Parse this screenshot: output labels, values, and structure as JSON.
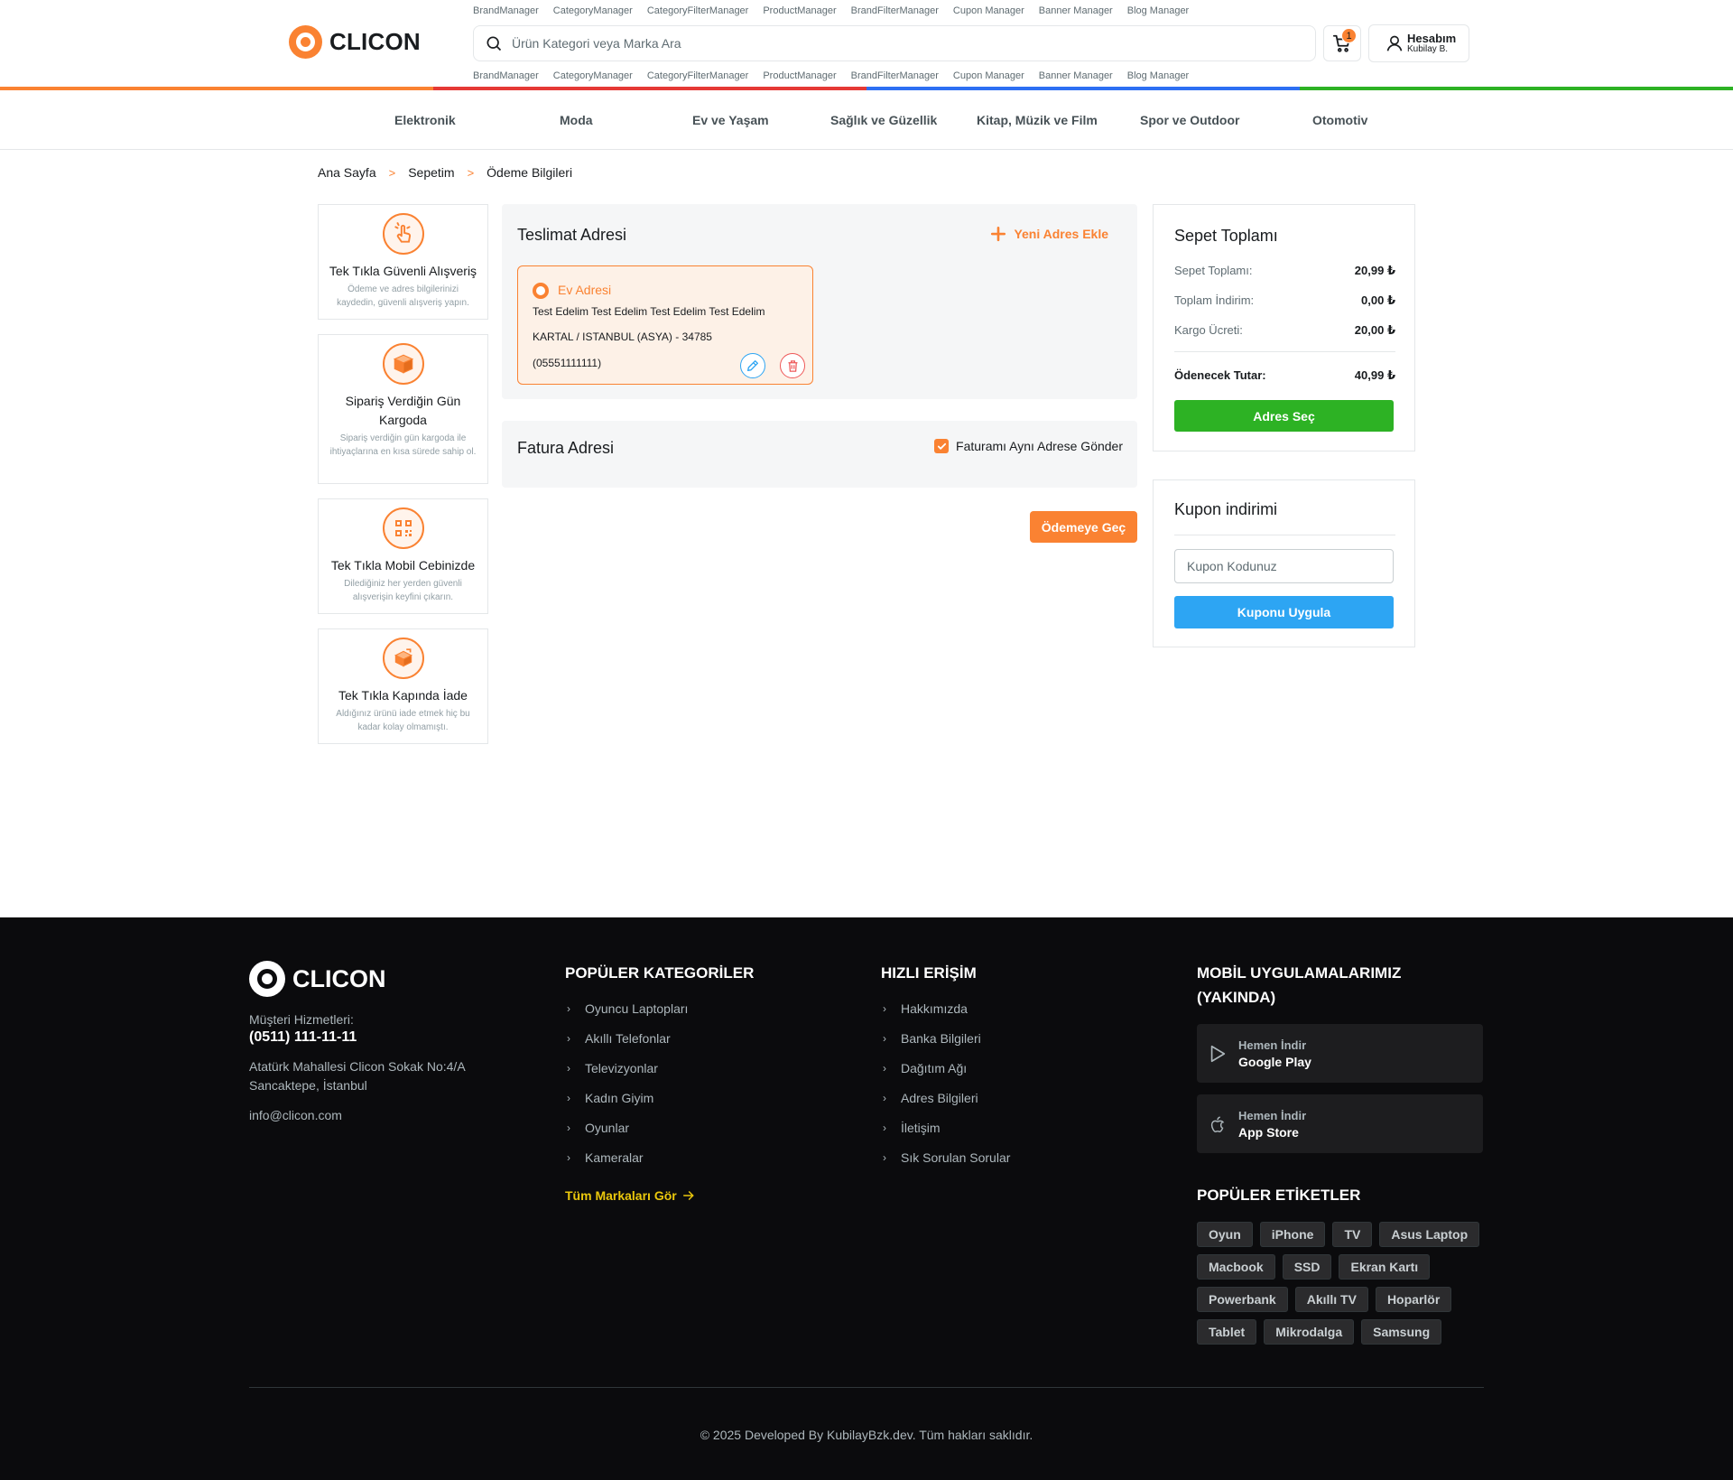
{
  "header": {
    "brand": "CLICON",
    "admin_links": [
      "BrandManager",
      "CategoryManager",
      "CategoryFilterManager",
      "ProductManager",
      "BrandFilterManager",
      "Cupon Manager",
      "Banner Manager",
      "Blog Manager"
    ],
    "search_placeholder": "Ürün Kategori veya Marka Ara",
    "cart_count": "1",
    "account_label": "Hesabım",
    "account_user": "Kubilay B.",
    "color_bar": [
      "#fa8232",
      "#e53935",
      "#2d6ff3",
      "#2db224"
    ]
  },
  "categories": [
    "Elektronik",
    "Moda",
    "Ev ve Yaşam",
    "Sağlık ve Güzellik",
    "Kitap, Müzik ve Film",
    "Spor ve Outdoor",
    "Otomotiv"
  ],
  "breadcrumb": [
    "Ana Sayfa",
    "Sepetim",
    "Ödeme Bilgileri"
  ],
  "features": [
    {
      "title": "Tek Tıkla Güvenli Alışveriş",
      "desc": "Ödeme ve adres bilgilerinizi kaydedin, güvenli alışveriş yapın.",
      "icon": "tap-icon"
    },
    {
      "title": "Sipariş Verdiğin Gün Kargoda",
      "desc": "Sipariş verdiğin gün kargoda ile ihtiyaçlarına en kısa sürede sahip ol.",
      "icon": "box-icon"
    },
    {
      "title": "Tek Tıkla Mobil Cebinizde",
      "desc": "Dilediğiniz her yerden güvenli alışverişin keyfini çıkarın.",
      "icon": "qr-icon"
    },
    {
      "title": "Tek Tıkla Kapında İade",
      "desc": "Aldığınız ürünü iade etmek hiç bu kadar kolay olmamıştı.",
      "icon": "return-icon"
    }
  ],
  "delivery": {
    "title": "Teslimat Adresi",
    "add_label": "Yeni Adres Ekle",
    "address": {
      "name": "Ev Adresi",
      "line1": "Test Edelim Test Edelim Test Edelim Test Edelim",
      "line2": "KARTAL / ISTANBUL (ASYA) - 34785",
      "phone": "(05551111111)"
    }
  },
  "invoice": {
    "title": "Fatura Adresi",
    "same_address_label": "Faturamı Aynı Adrese Gönder",
    "same_address_checked": true
  },
  "proceed_label": "Ödemeye Geç",
  "summary": {
    "title": "Sepet Toplamı",
    "rows": [
      {
        "label": "Sepet Toplamı:",
        "value": "20,99 ₺"
      },
      {
        "label": "Toplam İndirim:",
        "value": "0,00 ₺"
      },
      {
        "label": "Kargo Ücreti:",
        "value": "20,00 ₺"
      }
    ],
    "total_label": "Ödenecek Tutar:",
    "total_value": "40,99 ₺",
    "button": "Adres Seç"
  },
  "coupon": {
    "title": "Kupon indirimi",
    "placeholder": "Kupon Kodunuz",
    "button": "Kuponu Uygula"
  },
  "footer": {
    "brand": "CLICON",
    "support_label": "Müşteri Hizmetleri:",
    "phone": "(0511) 111-11-11",
    "address": "Atatürk Mahallesi Clicon Sokak No:4/A Sancaktepe, İstanbul",
    "email": "info@clicon.com",
    "popular_title": "POPÜLER KATEGORİLER",
    "popular": [
      "Oyuncu Laptopları",
      "Akıllı Telefonlar",
      "Televizyonlar",
      "Kadın Giyim",
      "Oyunlar",
      "Kameralar"
    ],
    "all_brands": "Tüm Markaları Gör",
    "quick_title": "HIZLI ERİŞİM",
    "quick": [
      "Hakkımızda",
      "Banka Bilgileri",
      "Dağıtım Ağı",
      "Adres Bilgileri",
      "İletişim",
      "Sık Sorulan Sorular"
    ],
    "apps_title": "MOBİL UYGULAMALARIMIZ (YAKINDA)",
    "apps": [
      {
        "top": "Hemen İndir",
        "name": "Google Play"
      },
      {
        "top": "Hemen İndir",
        "name": "App Store"
      }
    ],
    "tags_title": "POPÜLER ETİKETLER",
    "tags": [
      "Oyun",
      "iPhone",
      "TV",
      "Asus Laptop",
      "Macbook",
      "SSD",
      "Ekran Kartı",
      "Powerbank",
      "Akıllı TV",
      "Hoparlör",
      "Tablet",
      "Mikrodalga",
      "Samsung"
    ],
    "copyright": "© 2025 Developed By KubilayBzk.dev. Tüm hakları saklıdır."
  }
}
